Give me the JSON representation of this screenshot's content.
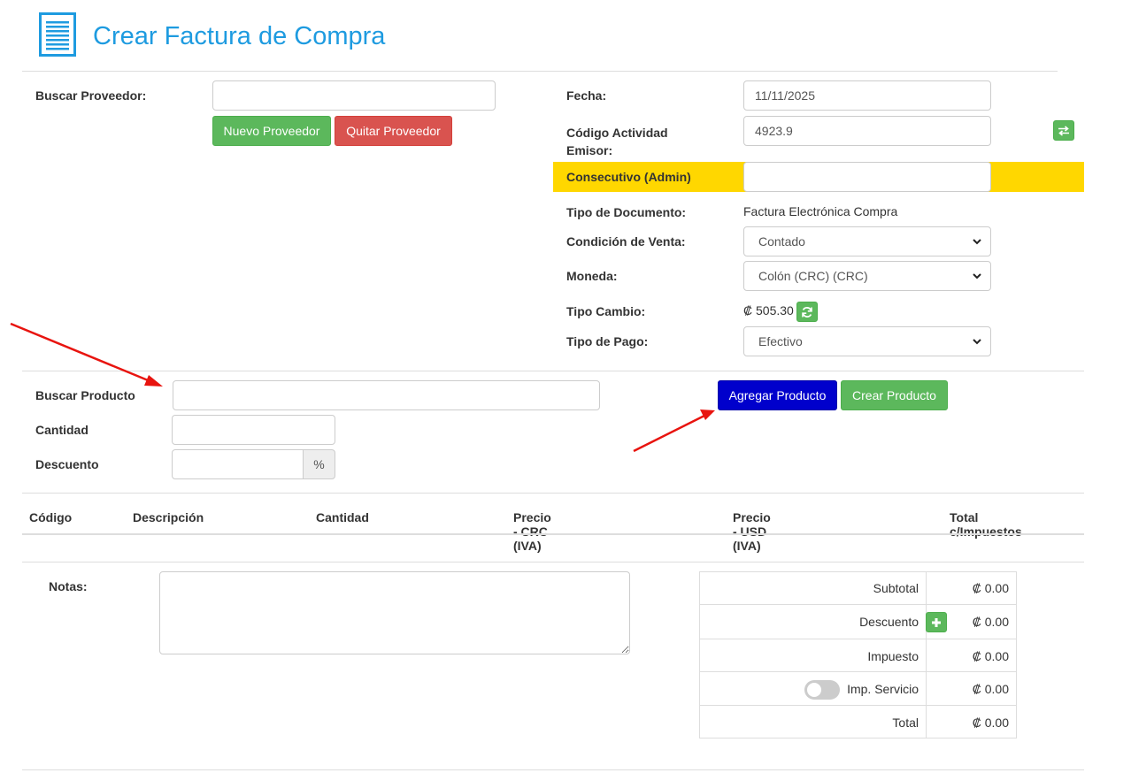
{
  "header": {
    "title": "Crear Factura de Compra",
    "icon": "list-document-icon",
    "title_color": "#1e9be0"
  },
  "supplier": {
    "search_label": "Buscar Proveedor:",
    "search_value": "",
    "new_button": "Nuevo Proveedor",
    "remove_button": "Quitar Proveedor"
  },
  "invoice": {
    "fecha_label": "Fecha:",
    "fecha_value": "11/11/2025",
    "actividad_label_line1": "Código Actividad",
    "actividad_label_line2": "Emisor:",
    "actividad_value": "4923.9",
    "consecutivo_label": "Consecutivo (Admin)",
    "consecutivo_value": "",
    "tipo_doc_label": "Tipo de Documento:",
    "tipo_doc_value": "Factura Electrónica Compra",
    "condicion_label": "Condición de Venta:",
    "condicion_value": "Contado",
    "moneda_label": "Moneda:",
    "moneda_value": "Colón (CRC) (CRC)",
    "tipo_cambio_label": "Tipo Cambio:",
    "tipo_cambio_value": "₡ 505.30",
    "tipo_pago_label": "Tipo de Pago:",
    "tipo_pago_value": "Efectivo"
  },
  "product": {
    "search_label": "Buscar Producto",
    "search_value": "",
    "cantidad_label": "Cantidad",
    "cantidad_value": "",
    "descuento_label": "Descuento",
    "descuento_value": "",
    "percent_addon": "%",
    "add_button": "Agregar Producto",
    "create_button": "Crear Producto"
  },
  "table": {
    "headers": [
      "Código",
      "Descripción",
      "Cantidad",
      "Precio - CRC (IVA)",
      "Precio - USD (IVA)",
      "Total c/Impuestos"
    ]
  },
  "notes": {
    "label": "Notas:",
    "value": ""
  },
  "totals": {
    "subtotal_label": "Subtotal",
    "subtotal_value": "₡ 0.00",
    "descuento_label": "Descuento",
    "descuento_value": "₡ 0.00",
    "impuesto_label": "Impuesto",
    "impuesto_value": "₡ 0.00",
    "servicio_label": "Imp. Servicio",
    "servicio_value": "₡ 0.00",
    "total_label": "Total",
    "total_value": "₡ 0.00"
  },
  "colors": {
    "success": "#5cb85c",
    "danger": "#d9534f",
    "primary_dark": "#0000cc",
    "highlight": "#ffd700",
    "annotation_arrow": "#e8140f"
  }
}
